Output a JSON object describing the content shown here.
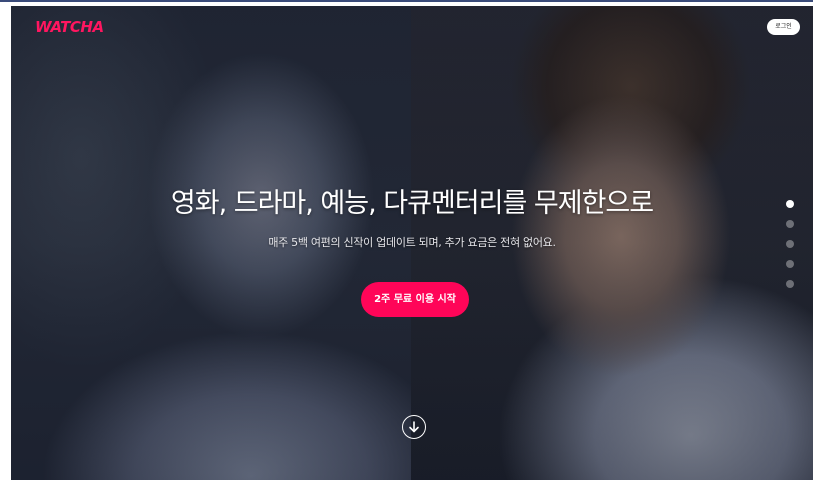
{
  "header": {
    "logo_text": "WATCHA",
    "login_label": "로그인"
  },
  "hero": {
    "headline": "영화, 드라마, 예능, 다큐멘터리를 무제한으로",
    "subline": "매주 5백 여편의 신작이 업데이트 되며, 추가 요금은 전혀 없어요.",
    "cta_label": "2주 무료 이용 시작",
    "scroll_icon": "arrow-down-circle-icon"
  },
  "pager": {
    "count": 5,
    "active_index": 0
  },
  "colors": {
    "brand": "#ff1660",
    "cta": "#ff0558",
    "text": "#ffffff"
  }
}
